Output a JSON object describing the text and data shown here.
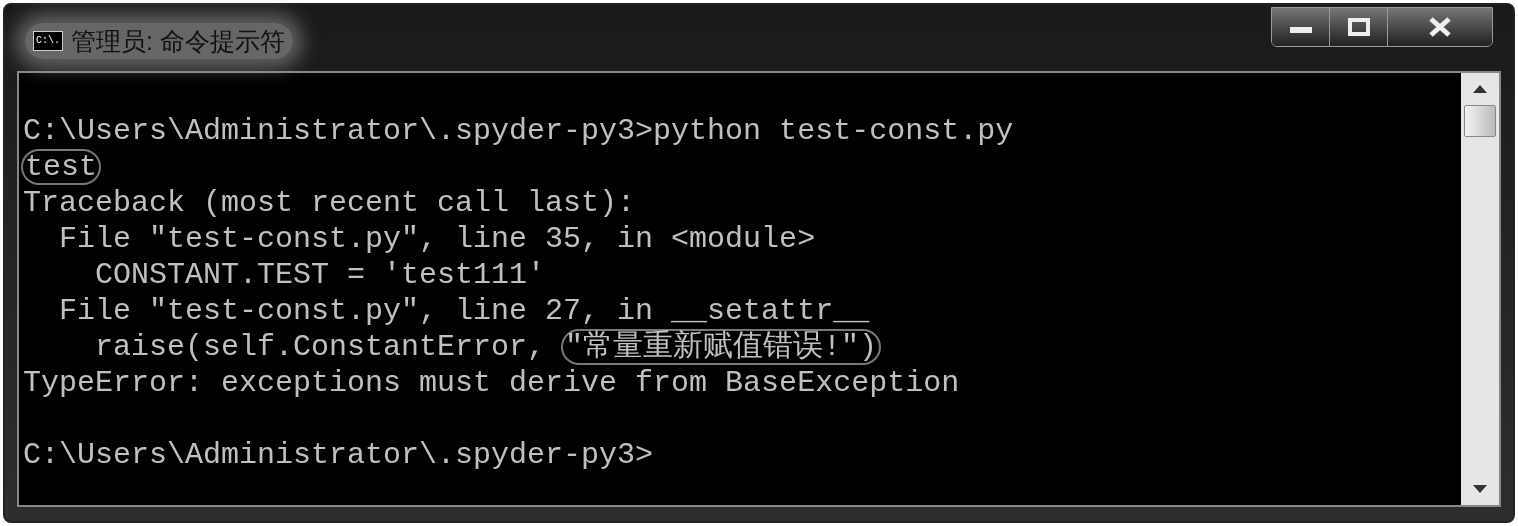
{
  "window": {
    "title": "管理员: 命令提示符",
    "icon_text": "C:\\."
  },
  "console": {
    "lines": [
      {
        "kind": "blank"
      },
      {
        "kind": "text",
        "segments": [
          {
            "text": "C:\\Users\\Administrator\\.spyder-py3>python test-const.py",
            "circled": false
          }
        ]
      },
      {
        "kind": "text",
        "segments": [
          {
            "text": "test",
            "circled": true
          }
        ]
      },
      {
        "kind": "text",
        "segments": [
          {
            "text": "Traceback (most recent call last):",
            "circled": false
          }
        ]
      },
      {
        "kind": "text",
        "segments": [
          {
            "text": "  File \"test-const.py\", line 35, in <module>",
            "circled": false
          }
        ]
      },
      {
        "kind": "text",
        "segments": [
          {
            "text": "    CONSTANT.TEST = 'test111'",
            "circled": false
          }
        ]
      },
      {
        "kind": "text",
        "segments": [
          {
            "text": "  File \"test-const.py\", line 27, in __setattr__",
            "circled": false
          }
        ]
      },
      {
        "kind": "text",
        "segments": [
          {
            "text": "    raise(self.ConstantError, ",
            "circled": false
          },
          {
            "text": "\"常量重新赋值错误!\")",
            "circled": true
          }
        ]
      },
      {
        "kind": "text",
        "segments": [
          {
            "text": "TypeError: exceptions must derive from BaseException",
            "circled": false
          }
        ]
      },
      {
        "kind": "blank"
      },
      {
        "kind": "text",
        "segments": [
          {
            "text": "C:\\Users\\Administrator\\.spyder-py3>",
            "circled": false
          }
        ]
      }
    ]
  }
}
